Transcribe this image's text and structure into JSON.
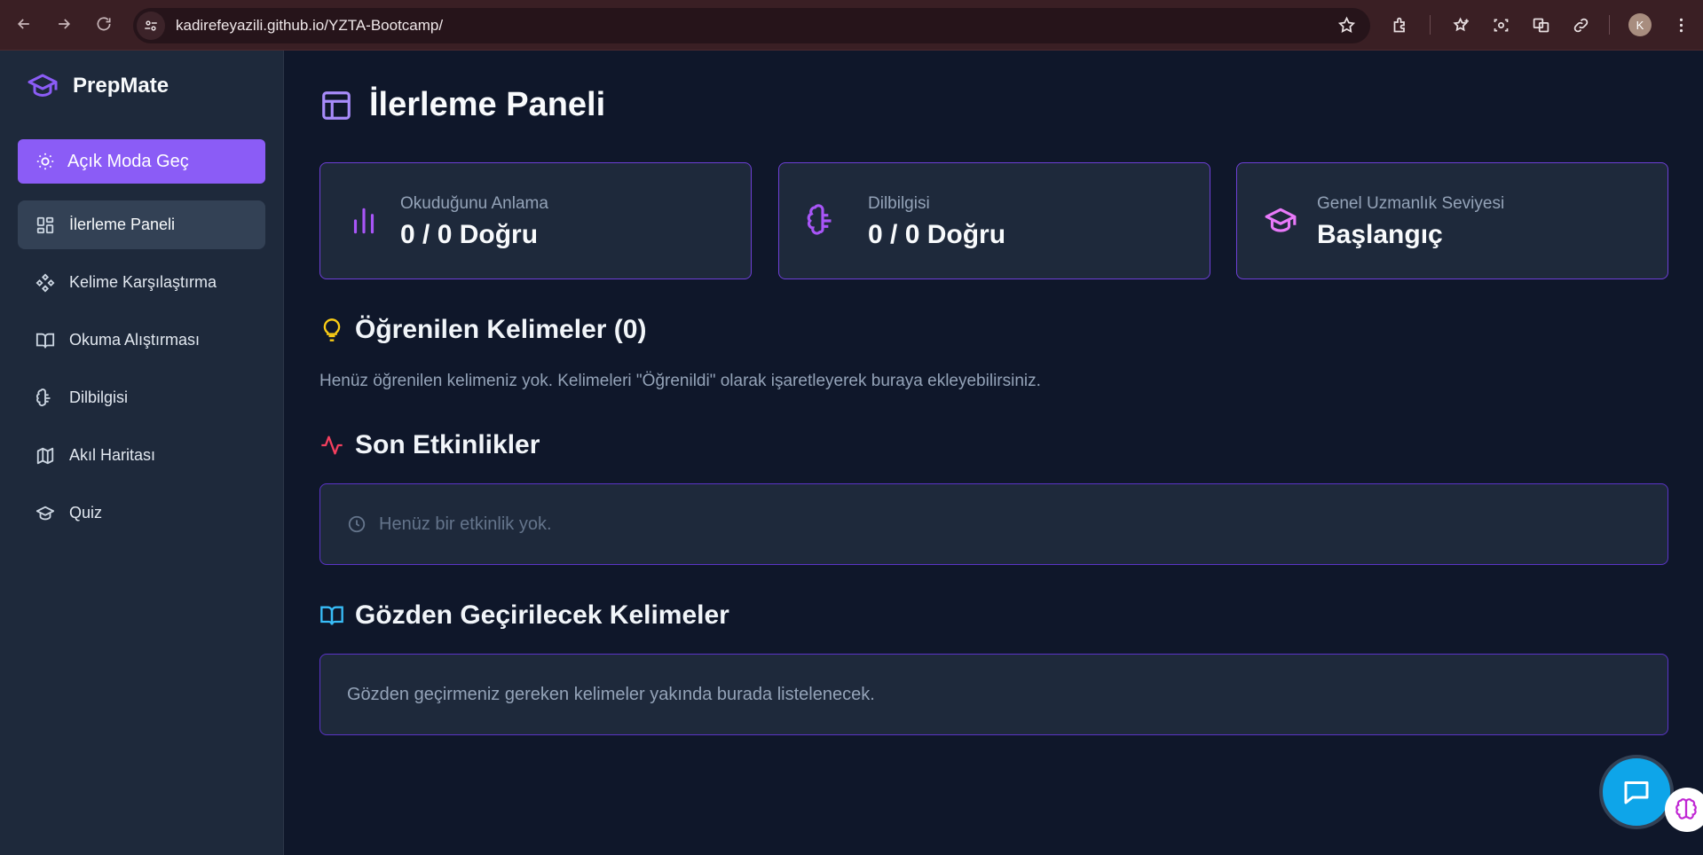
{
  "browser": {
    "url": "kadirefeyazili.github.io/YZTA-Bootcamp/",
    "profile_initial": "K"
  },
  "sidebar": {
    "brand": "PrepMate",
    "mode_button": "Açık Moda Geç",
    "items": [
      {
        "label": "İlerleme Paneli",
        "icon": "dashboard-icon",
        "active": true
      },
      {
        "label": "Kelime Karşılaştırma",
        "icon": "diamonds-icon",
        "active": false
      },
      {
        "label": "Okuma Alıştırması",
        "icon": "book-open-icon",
        "active": false
      },
      {
        "label": "Dilbilgisi",
        "icon": "brain-icon",
        "active": false
      },
      {
        "label": "Akıl Haritası",
        "icon": "map-icon",
        "active": false
      },
      {
        "label": "Quiz",
        "icon": "graduation-cap-icon",
        "active": false
      }
    ]
  },
  "main": {
    "title": "İlerleme Paneli",
    "cards": [
      {
        "label": "Okuduğunu Anlama",
        "value": "0 / 0 Doğru",
        "icon": "bar-chart-icon"
      },
      {
        "label": "Dilbilgisi",
        "value": "0 / 0 Doğru",
        "icon": "brain-icon"
      },
      {
        "label": "Genel Uzmanlık Seviyesi",
        "value": "Başlangıç",
        "icon": "graduation-cap-icon"
      }
    ],
    "learned": {
      "title": "Öğrenilen Kelimeler (0)",
      "description": "Henüz öğrenilen kelimeniz yok. Kelimeleri \"Öğrenildi\" olarak işaretleyerek buraya ekleyebilirsiniz."
    },
    "activities": {
      "title": "Son Etkinlikler",
      "empty": "Henüz bir etkinlik yok."
    },
    "review": {
      "title": "Gözden Geçirilecek Kelimeler",
      "text": "Gözden geçirmeniz gereken kelimeler yakında burada listelenecek."
    }
  },
  "colors": {
    "accent": "#8b5cf6",
    "bulb": "#facc15",
    "activity": "#f43f5e",
    "book": "#38bdf8",
    "chat": "#0ea5e9"
  }
}
